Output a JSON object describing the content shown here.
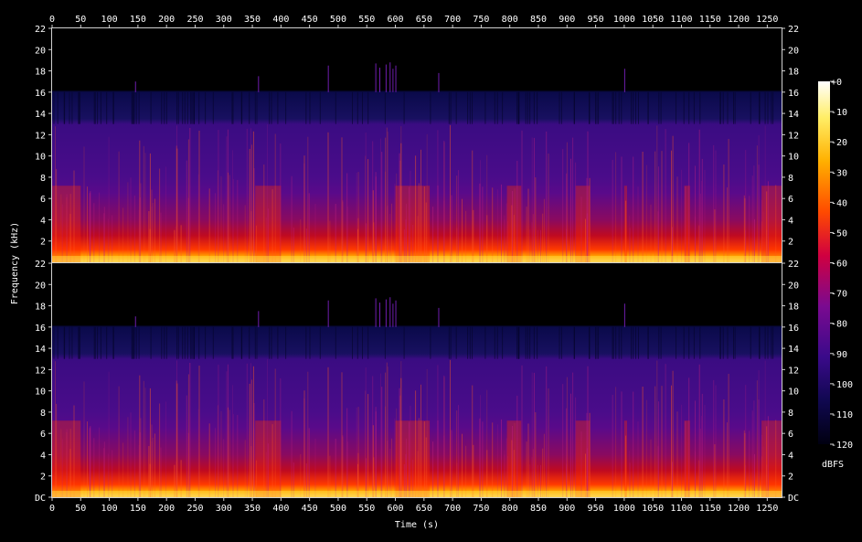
{
  "chart_data": {
    "type": "heatmap",
    "title": "",
    "xlabel": "Time (s)",
    "ylabel": "Frequency (kHz)",
    "xlim": [
      0,
      1275
    ],
    "x_ticks": [
      0,
      50,
      100,
      150,
      200,
      250,
      300,
      350,
      400,
      450,
      500,
      550,
      600,
      650,
      700,
      750,
      800,
      850,
      900,
      950,
      1000,
      1050,
      1100,
      1150,
      1200,
      1250
    ],
    "channels": [
      {
        "ylim": [
          0,
          22
        ],
        "y_ticks": [
          "22",
          "20",
          "18",
          "16",
          "14",
          "12",
          "10",
          "8",
          "6",
          "4",
          "2"
        ],
        "y_tick_values": [
          22,
          20,
          18,
          16,
          14,
          12,
          10,
          8,
          6,
          4,
          2
        ]
      },
      {
        "ylim": [
          0,
          22
        ],
        "y_ticks": [
          "22",
          "20",
          "18",
          "16",
          "14",
          "12",
          "10",
          "8",
          "6",
          "4",
          "2",
          "DC"
        ],
        "y_tick_values": [
          22,
          20,
          18,
          16,
          14,
          12,
          10,
          8,
          6,
          4,
          2,
          0
        ]
      }
    ],
    "colorbar": {
      "label": "dBFS",
      "range": [
        -120,
        0
      ],
      "ticks": [
        "+0",
        "-10",
        "-20",
        "-30",
        "-40",
        "-50",
        "-60",
        "-70",
        "-80",
        "-90",
        "-100",
        "-110",
        "-120"
      ],
      "tick_values": [
        0,
        -10,
        -20,
        -30,
        -40,
        -50,
        -60,
        -70,
        -80,
        -90,
        -100,
        -110,
        -120
      ]
    },
    "grid": false,
    "colors": {
      "background": "#000000",
      "low": "#000018",
      "mid": "#4a0a8a",
      "high": "#ff3000",
      "peak": "#ffffc8"
    }
  }
}
